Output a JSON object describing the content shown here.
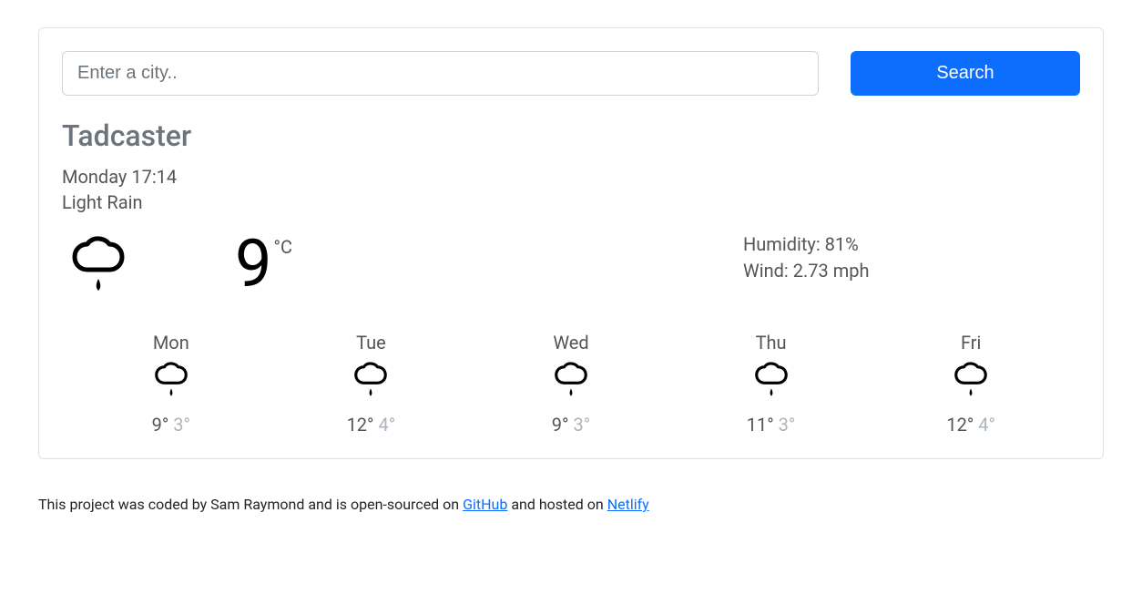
{
  "search": {
    "placeholder": "Enter a city..",
    "button_label": "Search"
  },
  "current": {
    "city": "Tadcaster",
    "datetime": "Monday 17:14",
    "description": "Light Rain",
    "temperature": "9",
    "unit": "°C",
    "icon": "rain-icon",
    "humidity_label": "Humidity: ",
    "humidity_value": "81%",
    "wind_label": "Wind: ",
    "wind_value": "2.73 mph"
  },
  "forecast": [
    {
      "day": "Mon",
      "icon": "rain-icon",
      "high": "9°",
      "low": "3°"
    },
    {
      "day": "Tue",
      "icon": "rain-icon",
      "high": "12°",
      "low": "4°"
    },
    {
      "day": "Wed",
      "icon": "rain-icon",
      "high": "9°",
      "low": "3°"
    },
    {
      "day": "Thu",
      "icon": "rain-icon",
      "high": "11°",
      "low": "3°"
    },
    {
      "day": "Fri",
      "icon": "rain-icon",
      "high": "12°",
      "low": "4°"
    }
  ],
  "footer": {
    "prefix": "This project was coded by Sam Raymond and is open-sourced on ",
    "link1_label": "GitHub",
    "mid": " and hosted on ",
    "link2_label": "Netlify"
  }
}
